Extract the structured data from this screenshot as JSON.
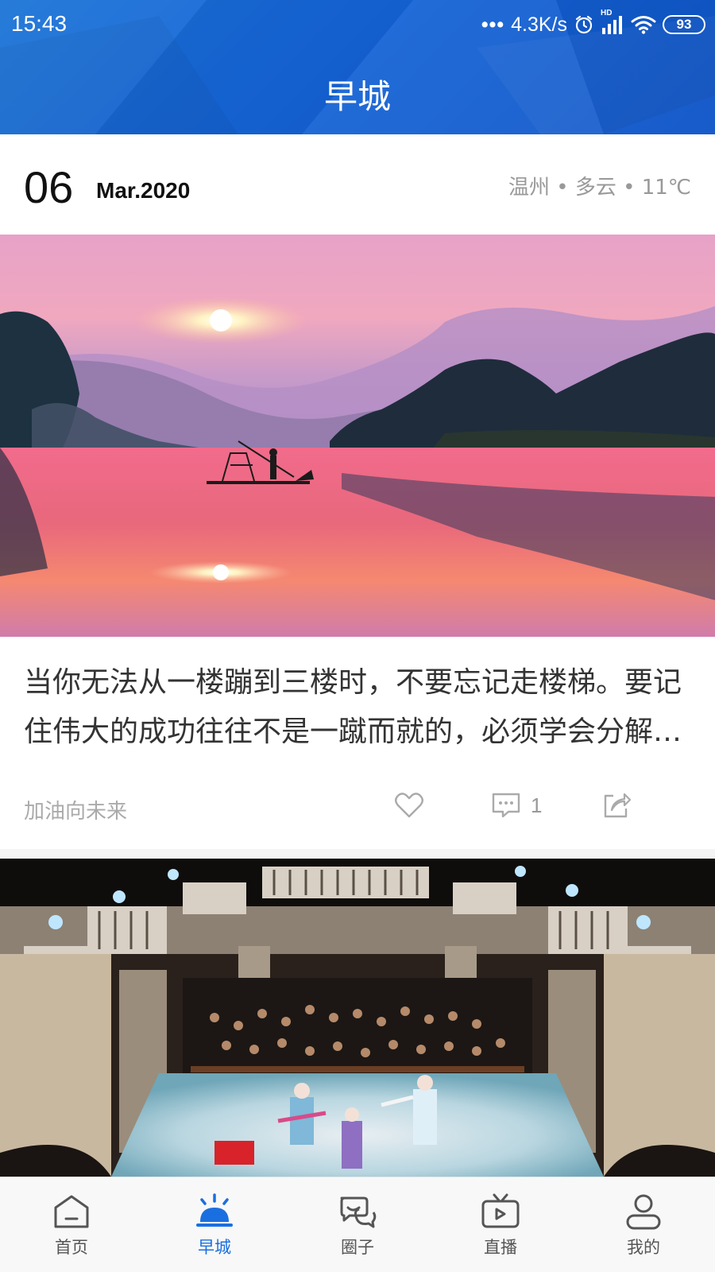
{
  "status_bar": {
    "time": "15:43",
    "network_speed": "4.3K/s",
    "network_badge": "HD",
    "battery": "93",
    "icons": [
      "more-dots-icon",
      "alarm-icon",
      "signal-icon",
      "wifi-icon",
      "battery-icon"
    ]
  },
  "header": {
    "title": "早城",
    "background_color": "#1565d8"
  },
  "date_row": {
    "day": "06",
    "month_year": "Mar.2020",
    "weather": "温州 • 多云 • 11℃"
  },
  "cards": [
    {
      "image": "sunset-river-fisherman-photo",
      "text": "当你无法从一楼蹦到三楼时，不要忘记走楼梯。要记住伟大的成功往往不是一蹴而就的，必须学会分解你的目标，逐步实施。",
      "author": "加油向未来",
      "likes_icon": "heart-icon",
      "comments_icon": "comment-icon",
      "comment_count": "1",
      "share_icon": "share-icon"
    },
    {
      "image": "opera-theater-stage-photo"
    }
  ],
  "bottom_nav": {
    "active_color": "#1a6fe0",
    "items": [
      {
        "label": "首页",
        "icon": "home-icon"
      },
      {
        "label": "早城",
        "icon": "sunrise-icon",
        "active": true
      },
      {
        "label": "圈子",
        "icon": "chat-bubbles-icon"
      },
      {
        "label": "直播",
        "icon": "tv-play-icon"
      },
      {
        "label": "我的",
        "icon": "user-icon"
      }
    ]
  }
}
